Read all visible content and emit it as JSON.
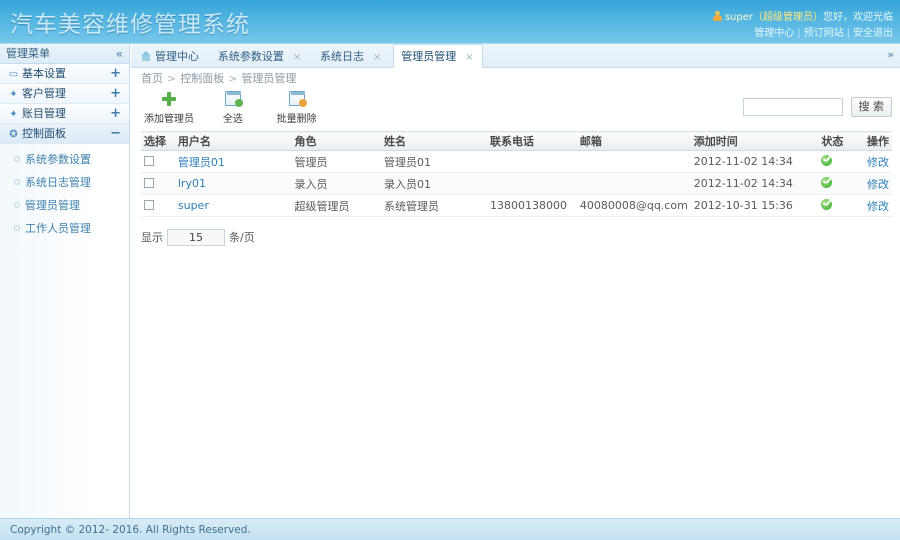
{
  "header": {
    "brand": "汽车美容维修管理系统",
    "user_prefix": "super",
    "user_role": "（超级管理员）",
    "greeting": "您好，欢迎光临",
    "links": [
      "管理中心",
      "预订网站",
      "安全退出"
    ],
    "link_sep": "|",
    "brand_color": "#cbe8f7",
    "bar_color": "#4fb3e0"
  },
  "sidebar": {
    "title": "管理菜单",
    "collapse_icon": "«",
    "groups": [
      {
        "label": "基本设置",
        "icon": "monitor-icon",
        "glyph": "▭",
        "toggle": "+",
        "active": false
      },
      {
        "label": "客户管理",
        "icon": "diamond-icon",
        "glyph": "✦",
        "toggle": "+",
        "active": false
      },
      {
        "label": "账目管理",
        "icon": "diamond-icon",
        "glyph": "✦",
        "toggle": "+",
        "active": false
      },
      {
        "label": "控制面板",
        "icon": "gear-icon",
        "glyph": "✪",
        "toggle": "−",
        "active": true
      }
    ],
    "items": [
      {
        "label": "系统参数设置"
      },
      {
        "label": "系统日志管理"
      },
      {
        "label": "管理员管理"
      },
      {
        "label": "工作人员管理"
      }
    ]
  },
  "tabs": {
    "more_icon": "»",
    "list": [
      {
        "label": "管理中心",
        "closable": false,
        "active": false,
        "home": true
      },
      {
        "label": "系统参数设置",
        "closable": true,
        "active": false,
        "home": false
      },
      {
        "label": "系统日志",
        "closable": true,
        "active": false,
        "home": false
      },
      {
        "label": "管理员管理",
        "closable": true,
        "active": true,
        "home": false
      }
    ],
    "close_glyph": "×"
  },
  "breadcrumb": {
    "sep": ">",
    "items": [
      "首页",
      "控制面板",
      "管理员管理"
    ]
  },
  "toolbar": {
    "buttons": [
      {
        "label": "添加管理员",
        "icon": "plus-icon"
      },
      {
        "label": "全选",
        "icon": "select-all-icon"
      },
      {
        "label": "批量删除",
        "icon": "batch-delete-icon"
      }
    ]
  },
  "search": {
    "value": "",
    "placeholder": "",
    "button_label": "搜 索"
  },
  "table": {
    "columns": [
      "选择",
      "用户名",
      "角色",
      "姓名",
      "联系电话",
      "邮箱",
      "添加时间",
      "状态",
      "操作"
    ],
    "rows": [
      {
        "select": "",
        "username": "管理员01",
        "role": "管理员",
        "name": "管理员01",
        "phone": "",
        "email": "",
        "created": "2012-11-02 14:34",
        "status": "active",
        "action": "修改"
      },
      {
        "select": "",
        "username": "lry01",
        "role": "录入员",
        "name": "录入员01",
        "phone": "",
        "email": "",
        "created": "2012-11-02 14:34",
        "status": "active",
        "action": "修改"
      },
      {
        "select": "",
        "username": "super",
        "role": "超级管理员",
        "name": "系统管理员",
        "phone": "13800138000",
        "email": "40080008@qq.com",
        "created": "2012-10-31 15:36",
        "status": "active",
        "action": "修改"
      }
    ]
  },
  "pager": {
    "prefix": "显示",
    "value": "15",
    "suffix": "条/页"
  },
  "footer": {
    "copyright": "Copyright © 2012- 2016. All Rights Reserved."
  }
}
